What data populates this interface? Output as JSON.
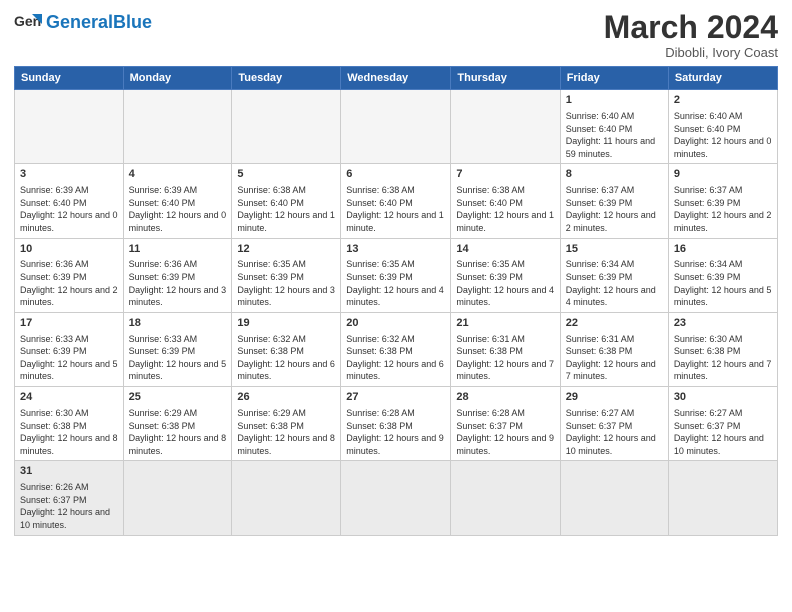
{
  "header": {
    "logo_general": "General",
    "logo_blue": "Blue",
    "month_title": "March 2024",
    "subtitle": "Dibobli, Ivory Coast"
  },
  "days_of_week": [
    "Sunday",
    "Monday",
    "Tuesday",
    "Wednesday",
    "Thursday",
    "Friday",
    "Saturday"
  ],
  "weeks": [
    [
      {
        "day": "",
        "info": ""
      },
      {
        "day": "",
        "info": ""
      },
      {
        "day": "",
        "info": ""
      },
      {
        "day": "",
        "info": ""
      },
      {
        "day": "",
        "info": ""
      },
      {
        "day": "1",
        "info": "Sunrise: 6:40 AM\nSunset: 6:40 PM\nDaylight: 11 hours\nand 59 minutes."
      },
      {
        "day": "2",
        "info": "Sunrise: 6:40 AM\nSunset: 6:40 PM\nDaylight: 12 hours\nand 0 minutes."
      }
    ],
    [
      {
        "day": "3",
        "info": "Sunrise: 6:39 AM\nSunset: 6:40 PM\nDaylight: 12 hours\nand 0 minutes."
      },
      {
        "day": "4",
        "info": "Sunrise: 6:39 AM\nSunset: 6:40 PM\nDaylight: 12 hours\nand 0 minutes."
      },
      {
        "day": "5",
        "info": "Sunrise: 6:38 AM\nSunset: 6:40 PM\nDaylight: 12 hours\nand 1 minute."
      },
      {
        "day": "6",
        "info": "Sunrise: 6:38 AM\nSunset: 6:40 PM\nDaylight: 12 hours\nand 1 minute."
      },
      {
        "day": "7",
        "info": "Sunrise: 6:38 AM\nSunset: 6:40 PM\nDaylight: 12 hours\nand 1 minute."
      },
      {
        "day": "8",
        "info": "Sunrise: 6:37 AM\nSunset: 6:39 PM\nDaylight: 12 hours\nand 2 minutes."
      },
      {
        "day": "9",
        "info": "Sunrise: 6:37 AM\nSunset: 6:39 PM\nDaylight: 12 hours\nand 2 minutes."
      }
    ],
    [
      {
        "day": "10",
        "info": "Sunrise: 6:36 AM\nSunset: 6:39 PM\nDaylight: 12 hours\nand 2 minutes."
      },
      {
        "day": "11",
        "info": "Sunrise: 6:36 AM\nSunset: 6:39 PM\nDaylight: 12 hours\nand 3 minutes."
      },
      {
        "day": "12",
        "info": "Sunrise: 6:35 AM\nSunset: 6:39 PM\nDaylight: 12 hours\nand 3 minutes."
      },
      {
        "day": "13",
        "info": "Sunrise: 6:35 AM\nSunset: 6:39 PM\nDaylight: 12 hours\nand 4 minutes."
      },
      {
        "day": "14",
        "info": "Sunrise: 6:35 AM\nSunset: 6:39 PM\nDaylight: 12 hours\nand 4 minutes."
      },
      {
        "day": "15",
        "info": "Sunrise: 6:34 AM\nSunset: 6:39 PM\nDaylight: 12 hours\nand 4 minutes."
      },
      {
        "day": "16",
        "info": "Sunrise: 6:34 AM\nSunset: 6:39 PM\nDaylight: 12 hours\nand 5 minutes."
      }
    ],
    [
      {
        "day": "17",
        "info": "Sunrise: 6:33 AM\nSunset: 6:39 PM\nDaylight: 12 hours\nand 5 minutes."
      },
      {
        "day": "18",
        "info": "Sunrise: 6:33 AM\nSunset: 6:39 PM\nDaylight: 12 hours\nand 5 minutes."
      },
      {
        "day": "19",
        "info": "Sunrise: 6:32 AM\nSunset: 6:38 PM\nDaylight: 12 hours\nand 6 minutes."
      },
      {
        "day": "20",
        "info": "Sunrise: 6:32 AM\nSunset: 6:38 PM\nDaylight: 12 hours\nand 6 minutes."
      },
      {
        "day": "21",
        "info": "Sunrise: 6:31 AM\nSunset: 6:38 PM\nDaylight: 12 hours\nand 7 minutes."
      },
      {
        "day": "22",
        "info": "Sunrise: 6:31 AM\nSunset: 6:38 PM\nDaylight: 12 hours\nand 7 minutes."
      },
      {
        "day": "23",
        "info": "Sunrise: 6:30 AM\nSunset: 6:38 PM\nDaylight: 12 hours\nand 7 minutes."
      }
    ],
    [
      {
        "day": "24",
        "info": "Sunrise: 6:30 AM\nSunset: 6:38 PM\nDaylight: 12 hours\nand 8 minutes."
      },
      {
        "day": "25",
        "info": "Sunrise: 6:29 AM\nSunset: 6:38 PM\nDaylight: 12 hours\nand 8 minutes."
      },
      {
        "day": "26",
        "info": "Sunrise: 6:29 AM\nSunset: 6:38 PM\nDaylight: 12 hours\nand 8 minutes."
      },
      {
        "day": "27",
        "info": "Sunrise: 6:28 AM\nSunset: 6:38 PM\nDaylight: 12 hours\nand 9 minutes."
      },
      {
        "day": "28",
        "info": "Sunrise: 6:28 AM\nSunset: 6:37 PM\nDaylight: 12 hours\nand 9 minutes."
      },
      {
        "day": "29",
        "info": "Sunrise: 6:27 AM\nSunset: 6:37 PM\nDaylight: 12 hours\nand 10 minutes."
      },
      {
        "day": "30",
        "info": "Sunrise: 6:27 AM\nSunset: 6:37 PM\nDaylight: 12 hours\nand 10 minutes."
      }
    ],
    [
      {
        "day": "31",
        "info": "Sunrise: 6:26 AM\nSunset: 6:37 PM\nDaylight: 12 hours\nand 10 minutes."
      },
      {
        "day": "",
        "info": ""
      },
      {
        "day": "",
        "info": ""
      },
      {
        "day": "",
        "info": ""
      },
      {
        "day": "",
        "info": ""
      },
      {
        "day": "",
        "info": ""
      },
      {
        "day": "",
        "info": ""
      }
    ]
  ]
}
